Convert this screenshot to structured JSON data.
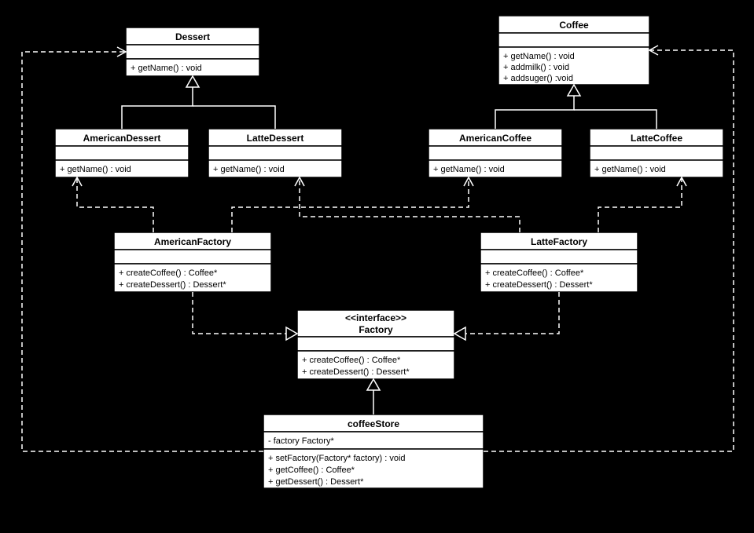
{
  "classes": {
    "dessert": {
      "name": "Dessert",
      "methods": [
        "+ getName() : void"
      ]
    },
    "americanDessert": {
      "name": "AmericanDessert",
      "methods": [
        "+ getName() : void"
      ]
    },
    "latteDessert": {
      "name": "LatteDessert",
      "methods": [
        "+ getName() : void"
      ]
    },
    "coffee": {
      "name": "Coffee",
      "methods": [
        "+ getName() : void",
        "+ addmilk() : void",
        "+ addsuger() :void"
      ]
    },
    "americanCoffee": {
      "name": "AmericanCoffee",
      "methods": [
        "+ getName() : void"
      ]
    },
    "latteCoffee": {
      "name": "LatteCoffee",
      "methods": [
        "+ getName() : void"
      ]
    },
    "americanFactory": {
      "name": "AmericanFactory",
      "methods": [
        "+ createCoffee() : Coffee*",
        "+ createDessert() : Dessert*"
      ]
    },
    "latteFactory": {
      "name": "LatteFactory",
      "methods": [
        "+ createCoffee() : Coffee*",
        "+ createDessert() : Dessert*"
      ]
    },
    "factory": {
      "stereotype": "<<interface>>",
      "name": "Factory",
      "methods": [
        "+ createCoffee() : Coffee*",
        "+ createDessert() : Dessert*"
      ]
    },
    "coffeeStore": {
      "name": "coffeeStore",
      "attributes": [
        "-  factory Factory*"
      ],
      "methods": [
        "+ setFactory(Factory* factory) : void",
        "+ getCoffee() : Coffee*",
        "+ getDessert() : Dessert*"
      ]
    }
  }
}
